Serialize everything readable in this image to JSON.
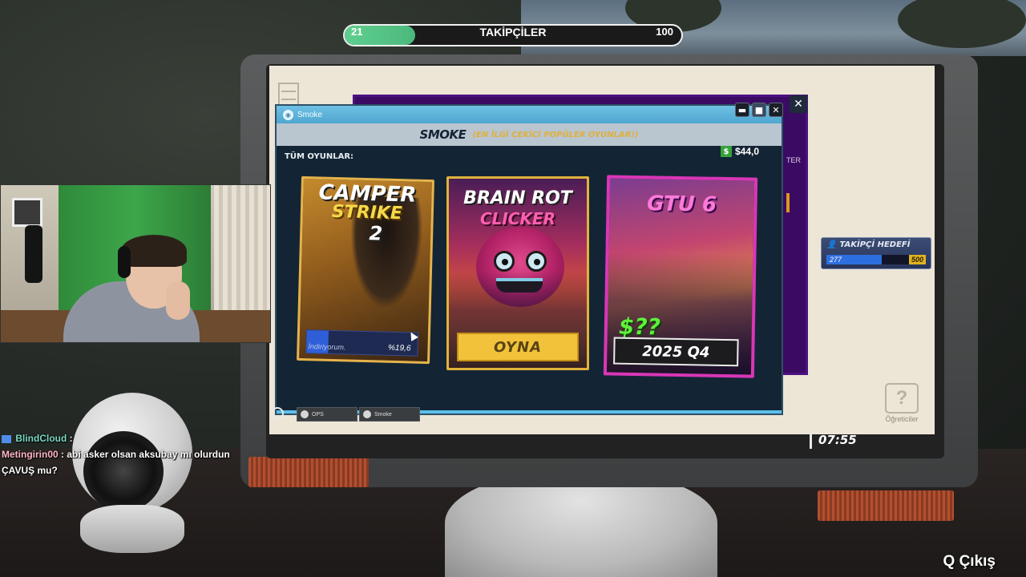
{
  "followers_bar": {
    "current": "21",
    "label": "TAKİPÇİLER",
    "max": "100",
    "progress": 0.21,
    "fill_color": "#5fcf8f"
  },
  "smoke_window": {
    "title": "Smoke",
    "header_logo": "SMOKE",
    "header_tagline": "(EN İLGİ ÇEKİCİ POPÜLER OYUNLAR!)",
    "section_label": "TÜM OYUNLAR:",
    "balance_icon": "$",
    "balance": "$44,0",
    "buttons": {
      "minimize": "▬",
      "maximize": "■",
      "close": "✕"
    }
  },
  "games": [
    {
      "title_line1": "CAMPER",
      "title_line2": "STRIKE",
      "title_line3": "2",
      "status": "İndiriyorum.",
      "percent": "%19,6",
      "download_progress": 0.196,
      "accent_color": "#e6b34a"
    },
    {
      "title_line1": "BRAIN ROT",
      "title_line2": "CLICKER",
      "action": "OYNA",
      "accent_color": "#f2c33a"
    },
    {
      "title_line1": "GTU 6",
      "price": "$??",
      "release": "2025 Q4",
      "accent_color": "#d936b7"
    }
  ],
  "back_window": {
    "close": "✕",
    "partial_text": "TER"
  },
  "follower_goal": {
    "title": "TAKİPÇİ HEDEFİ",
    "current": "277",
    "target": "500",
    "progress": 0.554
  },
  "desktop": {
    "help_icon_glyph": "?",
    "help_label": "Öğreticiler"
  },
  "taskbar": {
    "items": [
      {
        "label": "OPS"
      },
      {
        "label": "Smoke"
      }
    ],
    "clock": "07:55"
  },
  "chat": [
    {
      "user": "BlindCloud",
      "separator": ":",
      "message": ""
    },
    {
      "user": "Metingirin00",
      "separator": ":",
      "message": "abi asker olsan aksubay mı olurdun ÇAVUŞ mu?"
    }
  ],
  "exit_hint": "Q Çıkış"
}
